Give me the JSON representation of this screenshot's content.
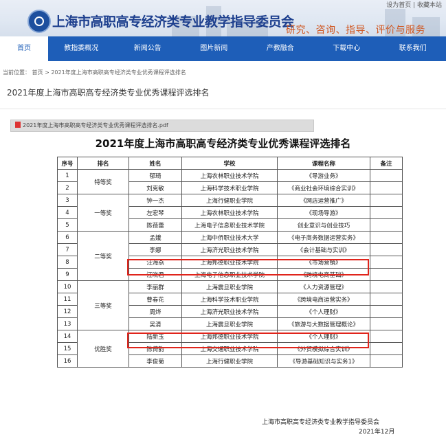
{
  "header": {
    "top_links": "设为首页 | 收藏本站",
    "site_title": "上海市高职高专经济类专业教学指导委员会",
    "slogan": "研究、咨询、指导、评价与服务"
  },
  "nav": [
    "首页",
    "教指委概况",
    "新闻公告",
    "图片新闻",
    "产教融合",
    "下载中心",
    "联系我们"
  ],
  "breadcrumb": "当前位置： 首页 > 2021年度上海市高职高专经济类专业优秀课程评选排名",
  "page_title": "2021年度上海市高职高专经济类专业优秀课程评选排名",
  "attachment": {
    "filename": "2021年度上海市高职高专经济类专业优秀课程评选排名.pdf"
  },
  "document": {
    "title": "2021年度上海市高职高专经济类专业优秀课程评选排名",
    "headers": [
      "序号",
      "排名",
      "姓名",
      "学校",
      "课程名称",
      "备注"
    ],
    "groups": [
      {
        "rank": "特等奖",
        "rows": [
          [
            "1",
            "郁琦",
            "上海农林职业技术学院",
            "《导游业务》"
          ],
          [
            "2",
            "刘克敏",
            "上海科学技术职业学院",
            "《商业社会环境综合实训》"
          ]
        ]
      },
      {
        "rank": "一等奖",
        "rows": [
          [
            "3",
            "钟一杰",
            "上海行健职业学院",
            "《网店运营推广》"
          ],
          [
            "4",
            "左宏琴",
            "上海农林职业技术学院",
            "《现场导游》"
          ],
          [
            "5",
            "陈蓓蕾",
            "上海电子信息职业技术学院",
            "创业意识与创业技巧"
          ]
        ]
      },
      {
        "rank": "二等奖",
        "rows": [
          [
            "6",
            "孟娥",
            "上海中侨职业技术大学",
            "《电子商务数据运营实务》"
          ],
          [
            "7",
            "李娜",
            "上海济光职业技术学院",
            "《会计基础与实训》"
          ],
          [
            "8",
            "汪海燕",
            "上海邦德职业技术学院",
            "《市场营销》"
          ],
          [
            "9",
            "汪晓君",
            "上海电子信息职业技术学院",
            "《跨境电商基础》"
          ]
        ]
      },
      {
        "rank": "三等奖",
        "rows": [
          [
            "10",
            "李丽群",
            "上海震旦职业学院",
            "《人力资源管理》"
          ],
          [
            "11",
            "曹春花",
            "上海科学技术职业学院",
            "《跨境电商运营实务》"
          ],
          [
            "12",
            "周烨",
            "上海济光职业技术学院",
            "《个人理财》"
          ],
          [
            "13",
            "吴清",
            "上海震旦职业学院",
            "《旅游与大数据管理概论》"
          ]
        ]
      },
      {
        "rank": "优胜奖",
        "rows": [
          [
            "14",
            "陆新玉",
            "上海邦德职业技术学院",
            "《个人理财》"
          ],
          [
            "15",
            "陈倚韵",
            "上海交通职业技术学院",
            "《外贸模拟综合实训》"
          ],
          [
            "16",
            "李俊菊",
            "上海行健职业学院",
            "《导游基础知识与实务1》"
          ]
        ]
      }
    ],
    "signature": "上海市高职高专经济类专业教学指导委员会",
    "date": "2021年12月"
  }
}
